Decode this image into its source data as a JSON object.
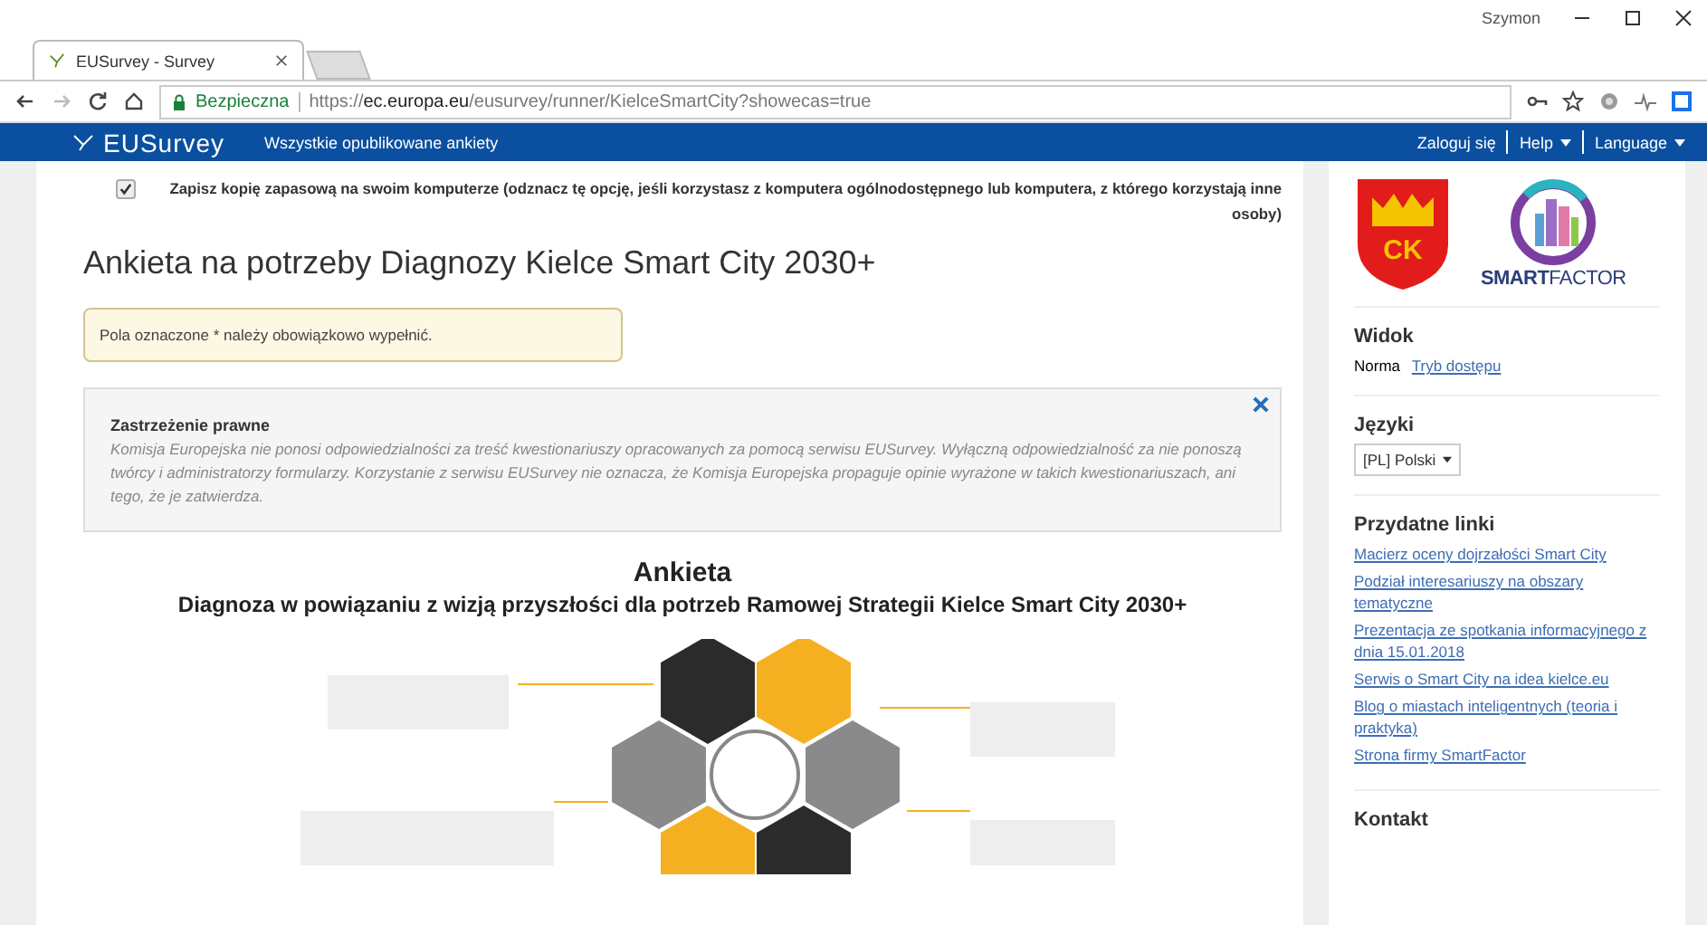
{
  "window": {
    "user": "Szymon"
  },
  "tabs": [
    {
      "label": "EUSurvey - Survey",
      "selected": true
    }
  ],
  "address_bar": {
    "security": "Bezpieczna",
    "url_scheme": "https://",
    "url_domain": "ec.europa.eu",
    "url_path": "/eusurvey/runner/KielceSmartCity?showecas=true"
  },
  "navbar": {
    "logo": "EUSurvey",
    "link": "Wszystkie opublikowane ankiety",
    "right": [
      {
        "label": "Zaloguj się",
        "dropdown": false
      },
      {
        "label": "Help",
        "dropdown": true
      },
      {
        "label": "Language",
        "dropdown": true
      }
    ]
  },
  "main": {
    "backup": {
      "checked": true,
      "label": "Zapisz kopię zapasową na swoim komputerze (odznacz tę opcję, jeśli korzystasz z komputera ogólnodostępnego lub komputera, z którego korzystają inne osoby)"
    },
    "title": "Ankieta na potrzeby Diagnozy Kielce Smart City 2030+",
    "notice": "Pola oznaczone * należy obowiązkowo wypełnić.",
    "disclaimer": {
      "title": "Zastrzeżenie prawne",
      "text": "Komisja Europejska nie ponosi odpowiedzialności za treść kwestionariuszy opracowanych za pomocą serwisu EUSurvey. Wyłączną odpowiedzialność za nie ponoszą twórcy i administratorzy formularzy. Korzystanie z serwisu EUSurvey nie oznacza, że Komisja Europejska propaguje opinie wyrażone w takich kwestionariuszach, ani tego, że je zatwierdza."
    },
    "survey_heading": "Ankieta",
    "survey_subtitle": "Diagnoza w powiązaniu z wizją przyszłości dla potrzeb Ramowej Strategii Kielce Smart City 2030+"
  },
  "sidebar": {
    "logos": {
      "city_badge": "CK",
      "brand_bold": "SMART",
      "brand_light": "FACTOR"
    },
    "view": {
      "title": "Widok",
      "current": "Norma",
      "link": "Tryb dostępu"
    },
    "languages": {
      "title": "Języki",
      "value": "[PL] Polski"
    },
    "links": {
      "title": "Przydatne linki",
      "items": [
        "Macierz oceny dojrzałości Smart City",
        "Podział interesariuszy na obszary tematyczne",
        "Prezentacja ze spotkania informacyjnego z dnia 15.01.2018",
        "Serwis o Smart City na idea kielce.eu",
        "Blog o miastach inteligentnych (teoria i praktyka)",
        "Strona firmy SmartFactor"
      ]
    },
    "contact": {
      "title": "Kontakt"
    }
  }
}
